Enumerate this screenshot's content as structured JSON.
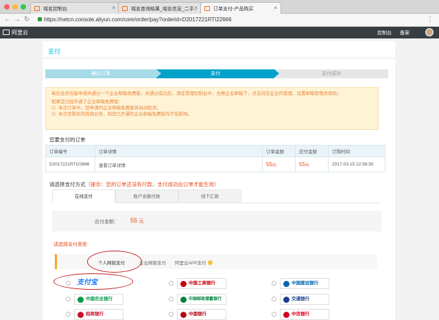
{
  "browser": {
    "tabs": [
      {
        "label": "域名控制台",
        "active": false
      },
      {
        "label": "域名查询结果_域名信息_二手..",
        "active": false
      },
      {
        "label": "订单支付-产品购买",
        "active": true
      }
    ],
    "url": "https://netcn.console.aliyun.com/core/order/pay?orderid=D2017221RTI22666"
  },
  "topbar": {
    "logo": "阿里云",
    "console_link": "控制台",
    "beian_link": "备案"
  },
  "page": {
    "title": "支付",
    "steps": [
      "确认订单",
      "支付",
      "支付成功"
    ],
    "notice": [
      "每位会员仅能申请并通过一个企业邮箱免费版，并通过成功后，请在管理控制台中，左侧企业邮箱下，点击对应企业的管理，设置邮箱管理员密码；",
      "如果您已经开通了企业邮箱免费版：",
      "1）本次订单中，您申请的企业邮箱免费版将自动取消；",
      "2）本次您购买的其他业务，和您已开通的企业邮箱免费版均不受影响。"
    ],
    "orders_title": "您要支付的订单",
    "table": {
      "headers": [
        "订单编号",
        "订单详情",
        "订单金额",
        "应付金额",
        "订购时间"
      ],
      "rows": [
        {
          "id": "D2017221RTI22666",
          "detail": "查看订单详情",
          "amount": "55",
          "payable": "55",
          "unit": "元",
          "time": "2017-03-15 22:58:30"
        }
      ]
    },
    "pay_method_title": "请选择支付方式",
    "pay_method_tip": "（提示：您的订单还没有付款，支付成功后订单才能生效）",
    "pay_tabs": [
      "在线支付",
      "账户余额付款",
      "线下汇款"
    ],
    "amount_label": "应付金额：",
    "amount_value": "55",
    "amount_unit": "元",
    "pay_type_title": "请选择支付类型",
    "type_tabs": [
      "个人网银支付",
      "企业网银支付",
      "阿里云APP支付"
    ],
    "banks": [
      {
        "name": "支付宝",
        "color": "#1677ff"
      },
      {
        "name": "中国工商银行",
        "color": "#c7000b"
      },
      {
        "name": "中国建设银行",
        "color": "#0066b3"
      },
      {
        "name": "中国农业银行",
        "color": "#009b4a"
      },
      {
        "name": "中国邮政储蓄银行",
        "color": "#00843d"
      },
      {
        "name": "交通银行",
        "color": "#1b3f8f"
      },
      {
        "name": "招商银行",
        "color": "#c8102e"
      },
      {
        "name": "中国银行",
        "color": "#b40a1a"
      },
      {
        "name": "中信银行",
        "color": "#d2001e"
      }
    ]
  }
}
